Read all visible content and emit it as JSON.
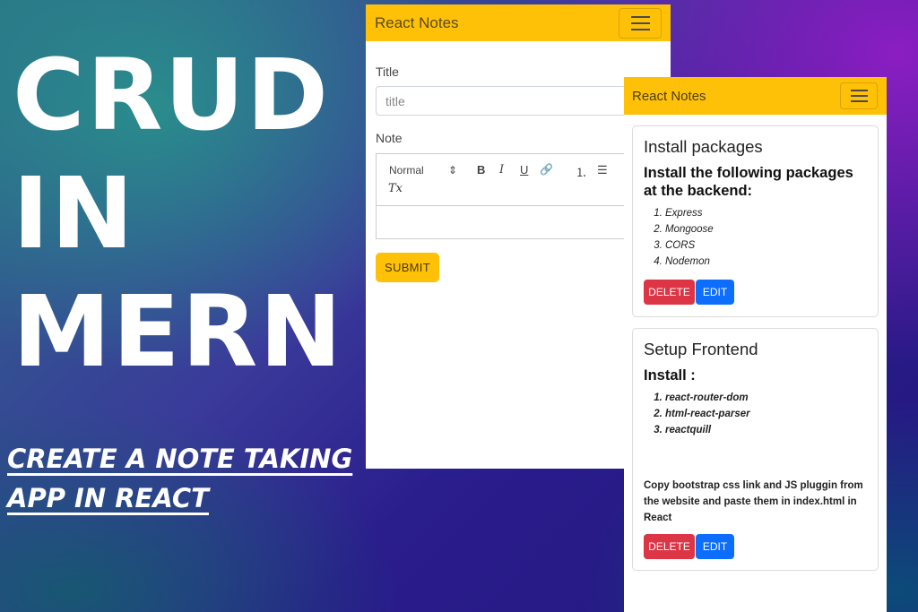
{
  "headline": {
    "line1": "CRUD",
    "line2": "IN",
    "line3": "MERN"
  },
  "subhead": {
    "line1": "CREATE A NOTE TAKING",
    "line2": "APP IN REACT"
  },
  "form_window": {
    "brand": "React Notes",
    "title_label": "Title",
    "title_placeholder": "title",
    "note_label": "Note",
    "toolbar": {
      "heading_select": "Normal",
      "bold": "B",
      "italic": "I",
      "underline": "U",
      "link": "🔗",
      "ordered_list": "⒈",
      "bullet_list": "☰",
      "clear_format": "Tx"
    },
    "submit_label": "SUBMIT"
  },
  "notes_window": {
    "brand": "React Notes",
    "notes": [
      {
        "title": "Install packages",
        "subtitle": "Install the following packages at the backend:",
        "items": [
          "Express",
          "Mongoose",
          "CORS",
          "Nodemon"
        ],
        "paragraph": "",
        "delete_label": "DELETE",
        "edit_label": "EDIT"
      },
      {
        "title": "Setup Frontend",
        "subtitle": "Install :",
        "items": [
          "react-router-dom",
          "html-react-parser",
          "reactquill"
        ],
        "paragraph": "Copy bootstrap css link and JS pluggin from the website and paste them in index.html in React",
        "delete_label": "DELETE",
        "edit_label": "EDIT"
      }
    ]
  },
  "colors": {
    "navbar": "#ffc107",
    "delete": "#dc3545",
    "edit": "#0d6efd"
  }
}
